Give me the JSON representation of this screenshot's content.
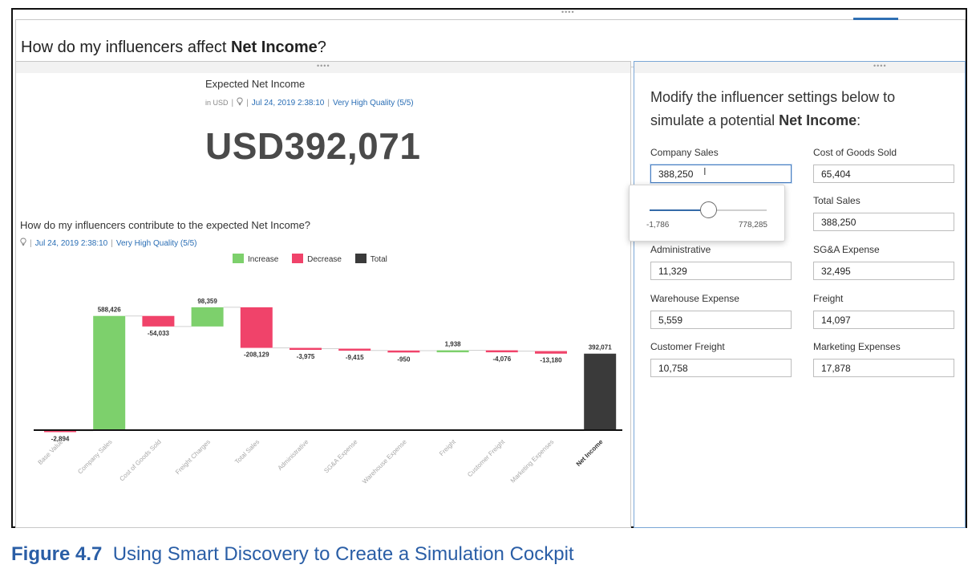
{
  "header": {
    "title_prefix": "How do my influencers affect ",
    "title_bold": "Net Income",
    "title_suffix": "?"
  },
  "kpi": {
    "title": "Expected Net Income",
    "unit": "in USD",
    "timestamp": "Jul 24, 2019 2:38:10",
    "quality": "Very High Quality (5/5)",
    "value": "USD392,071"
  },
  "waterfall": {
    "title": "How do my influencers contribute to the expected Net Income?",
    "timestamp": "Jul 24, 2019 2:38:10",
    "quality": "Very High Quality (5/5)",
    "legend": [
      {
        "label": "Increase",
        "color": "#7dd06c"
      },
      {
        "label": "Decrease",
        "color": "#f0436a"
      },
      {
        "label": "Total",
        "color": "#3a3a3a"
      }
    ]
  },
  "chart_data": {
    "type": "bar",
    "subtype": "waterfall",
    "title": "How do my influencers contribute to the expected Net Income?",
    "categories": [
      "Base Value",
      "Company Sales",
      "Cost of Goods Sold",
      "Freight Charges",
      "Total Sales",
      "Administrative",
      "SG&A Expense",
      "Warehouse Expense",
      "Freight",
      "Customer Freight",
      "Marketing Expenses",
      "Net Income"
    ],
    "values": [
      -2894,
      588426,
      -54033,
      98359,
      -208129,
      -3975,
      -9415,
      -950,
      1938,
      -4076,
      -13180,
      392071
    ],
    "labels": [
      "-2,894",
      "588,426",
      "-54,033",
      "98,359",
      "-208,129",
      "-3,975",
      "-9,415",
      "-950",
      "1,938",
      "-4,076",
      "-13,180",
      "392,071"
    ],
    "kinds": [
      "decrease",
      "increase",
      "decrease",
      "increase",
      "decrease",
      "decrease",
      "decrease",
      "decrease",
      "increase",
      "decrease",
      "decrease",
      "total"
    ],
    "ylim": [
      -30000,
      660000
    ],
    "grid": false,
    "legend_position": "top-center"
  },
  "simulation": {
    "heading_prefix": "Modify the influencer settings below to simulate a potential ",
    "heading_bold": "Net Income",
    "heading_suffix": ":",
    "fields": [
      {
        "label": "Company Sales",
        "value": "388,250",
        "active": true
      },
      {
        "label": "Cost of Goods Sold",
        "value": "65,404"
      },
      {
        "label": "Total Sales",
        "value": "388,250"
      },
      {
        "label": "Administrative",
        "value": "11,329"
      },
      {
        "label": "SG&A Expense",
        "value": "32,495"
      },
      {
        "label": "Warehouse Expense",
        "value": "5,559"
      },
      {
        "label": "Freight",
        "value": "14,097"
      },
      {
        "label": "Customer Freight",
        "value": "10,758"
      },
      {
        "label": "Marketing Expenses",
        "value": "17,878"
      }
    ],
    "slider": {
      "min_label": "-1,786",
      "max_label": "778,285",
      "min": -1786,
      "max": 778285,
      "value": 388250
    }
  },
  "caption": {
    "figure": "Figure 4.7",
    "text": "Using Smart Discovery to Create a Simulation Cockpit"
  },
  "colors": {
    "increase": "#7dd06c",
    "decrease": "#f0436a",
    "total": "#3a3a3a",
    "link": "#2a6eb5",
    "caption": "#2a5ea6"
  },
  "icons": {
    "grip": "grip-dots-icon",
    "info": "lightbulb-icon",
    "text_cursor": "text-cursor-icon"
  }
}
